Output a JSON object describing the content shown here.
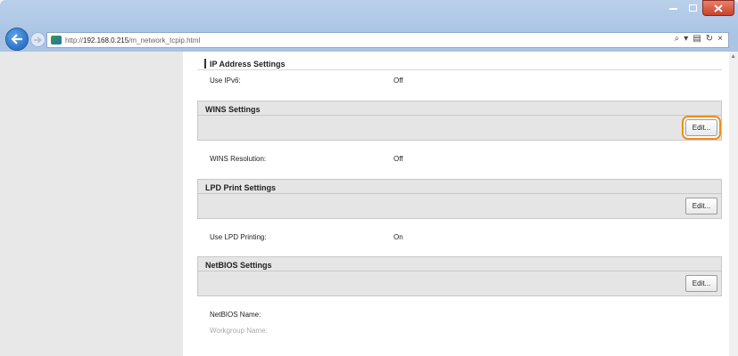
{
  "browser": {
    "url_prefix": "http://",
    "url_host": "192.168.0.215",
    "url_path": "/m_network_tcpip.html",
    "search_glyph": "ρ – ≡ ć ×"
  },
  "sections": {
    "ip_address": {
      "title": "IP Address Settings",
      "rows": [
        {
          "label": "Use IPv6:",
          "value": "Off"
        }
      ]
    },
    "wins": {
      "title": "WINS Settings",
      "edit_label": "Edit...",
      "rows": [
        {
          "label": "WINS Resolution:",
          "value": "Off"
        }
      ]
    },
    "lpd": {
      "title": "LPD Print Settings",
      "edit_label": "Edit...",
      "rows": [
        {
          "label": "Use LPD Printing:",
          "value": "On"
        }
      ]
    },
    "netbios": {
      "title": "NetBIOS Settings",
      "edit_label": "Edit...",
      "rows": [
        {
          "label": "NetBIOS Name:",
          "value": ""
        },
        {
          "label": "Workgroup Name:",
          "value": ""
        }
      ]
    }
  },
  "colors": {
    "highlight": "#f08c1a",
    "section_bg": "#e5e5e5",
    "left_pane": "#e8e8e8"
  }
}
